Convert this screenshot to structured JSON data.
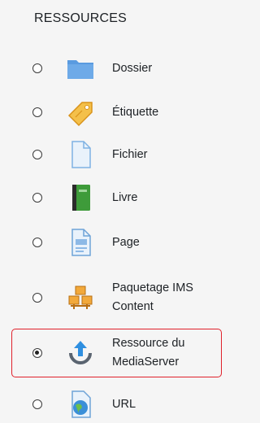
{
  "section": {
    "title": "RESSOURCES"
  },
  "items": [
    {
      "label": "Dossier",
      "icon": "folder-icon",
      "selected": false
    },
    {
      "label": "Étiquette",
      "icon": "label-tag-icon",
      "selected": false
    },
    {
      "label": "Fichier",
      "icon": "file-icon",
      "selected": false
    },
    {
      "label": "Livre",
      "icon": "book-icon",
      "selected": false
    },
    {
      "label": "Page",
      "icon": "page-icon",
      "selected": false
    },
    {
      "label_line1": "Paquetage IMS",
      "label_line2": "Content",
      "icon": "ims-package-icon",
      "selected": false
    },
    {
      "label_line1": "Ressource du",
      "label_line2": "MediaServer",
      "icon": "mediaserver-upload-icon",
      "selected": true
    },
    {
      "label": "URL",
      "icon": "url-globe-icon",
      "selected": false
    }
  ],
  "colors": {
    "background": "#f5f5f5",
    "highlight_border": "#e0212b",
    "folder": "#4f8fd6",
    "tag": "#f2b134",
    "book": "#3e9b3a",
    "mediaserver": "#2f8fe0"
  }
}
